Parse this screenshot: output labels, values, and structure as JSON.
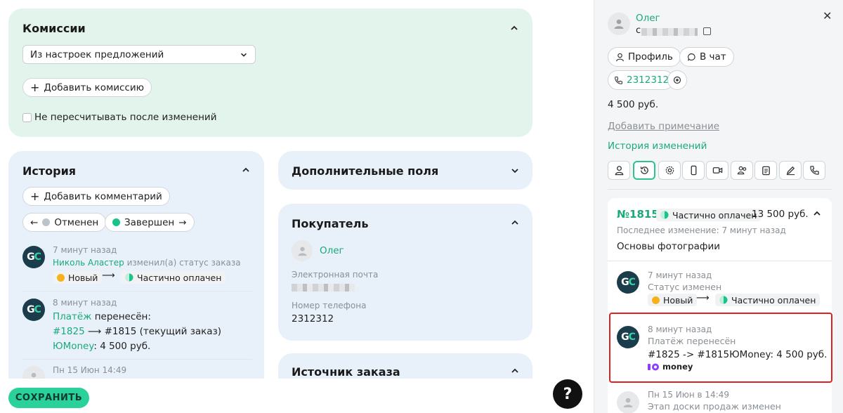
{
  "commissions": {
    "title": "Комиссии",
    "select_value": "Из настроек предложений",
    "add_button": "Добавить комиссию",
    "checkbox_label": "Не пересчитывать после изменений"
  },
  "history": {
    "title": "История",
    "add_comment": "Добавить комментарий",
    "filter_cancelled": "Отменен",
    "filter_completed": "Завершен",
    "entries": [
      {
        "time": "7 минут назад",
        "author": "Николь Аластер",
        "action": "изменил(а) статус заказа",
        "from": "Новый",
        "to": "Частично оплачен"
      },
      {
        "time": "8 минут назад",
        "line1_link": "Платёж",
        "line1_text": "перенесён:",
        "line2_link": "#1825",
        "line2_text": "⟶ #1815 (текущий заказ)",
        "line3_link": "ЮMoney",
        "line3_text": ": 4 500 руб."
      },
      {
        "time": "Пн 15 Июн 14:49"
      }
    ]
  },
  "extra_fields": {
    "title": "Дополнительные поля"
  },
  "buyer": {
    "title": "Покупатель",
    "name": "Олег",
    "email_label": "Электронная почта",
    "phone_label": "Номер телефона",
    "phone": "2312312"
  },
  "order_source": {
    "title": "Источник заказа"
  },
  "footer": {
    "save": "СОХРАНИТЬ",
    "help": "?"
  },
  "sidebar": {
    "user_name": "Олег",
    "user_initial": "с",
    "profile_btn": "Профиль",
    "chat_btn": "В чат",
    "phone": "2312312",
    "amount": "4 500 руб.",
    "add_note": "Добавить примечание",
    "change_history": "История изменений",
    "icons": [
      "user-icon",
      "history-icon",
      "gear-icon",
      "mobile-icon",
      "video-icon",
      "users-icon",
      "clipboard-icon",
      "pen-icon",
      "phone-icon"
    ],
    "order": {
      "number": "№1815",
      "status": "Частично оплачен",
      "sum": "13 500 руб.",
      "last_change": "Последнее изменение: 7 минут назад",
      "product": "Основы фотографии"
    },
    "events": [
      {
        "time": "7 минут назад",
        "title": "Статус изменен",
        "from": "Новый",
        "to": "Частично оплачен"
      },
      {
        "time": "8 минут назад",
        "title": "Платёж перенесён",
        "text": "#1825 -> #1815ЮMoney: 4 500 руб.",
        "logo": "money"
      },
      {
        "time": "Пн 15 Июн в 14:49",
        "title": "Этап доски продаж изменен"
      }
    ]
  },
  "colors": {
    "accent": "#1aa97a",
    "green_card": "#e3f4ec",
    "blue_card": "#e8f1fa",
    "save": "#2bd19a",
    "highlight": "#e02020"
  }
}
